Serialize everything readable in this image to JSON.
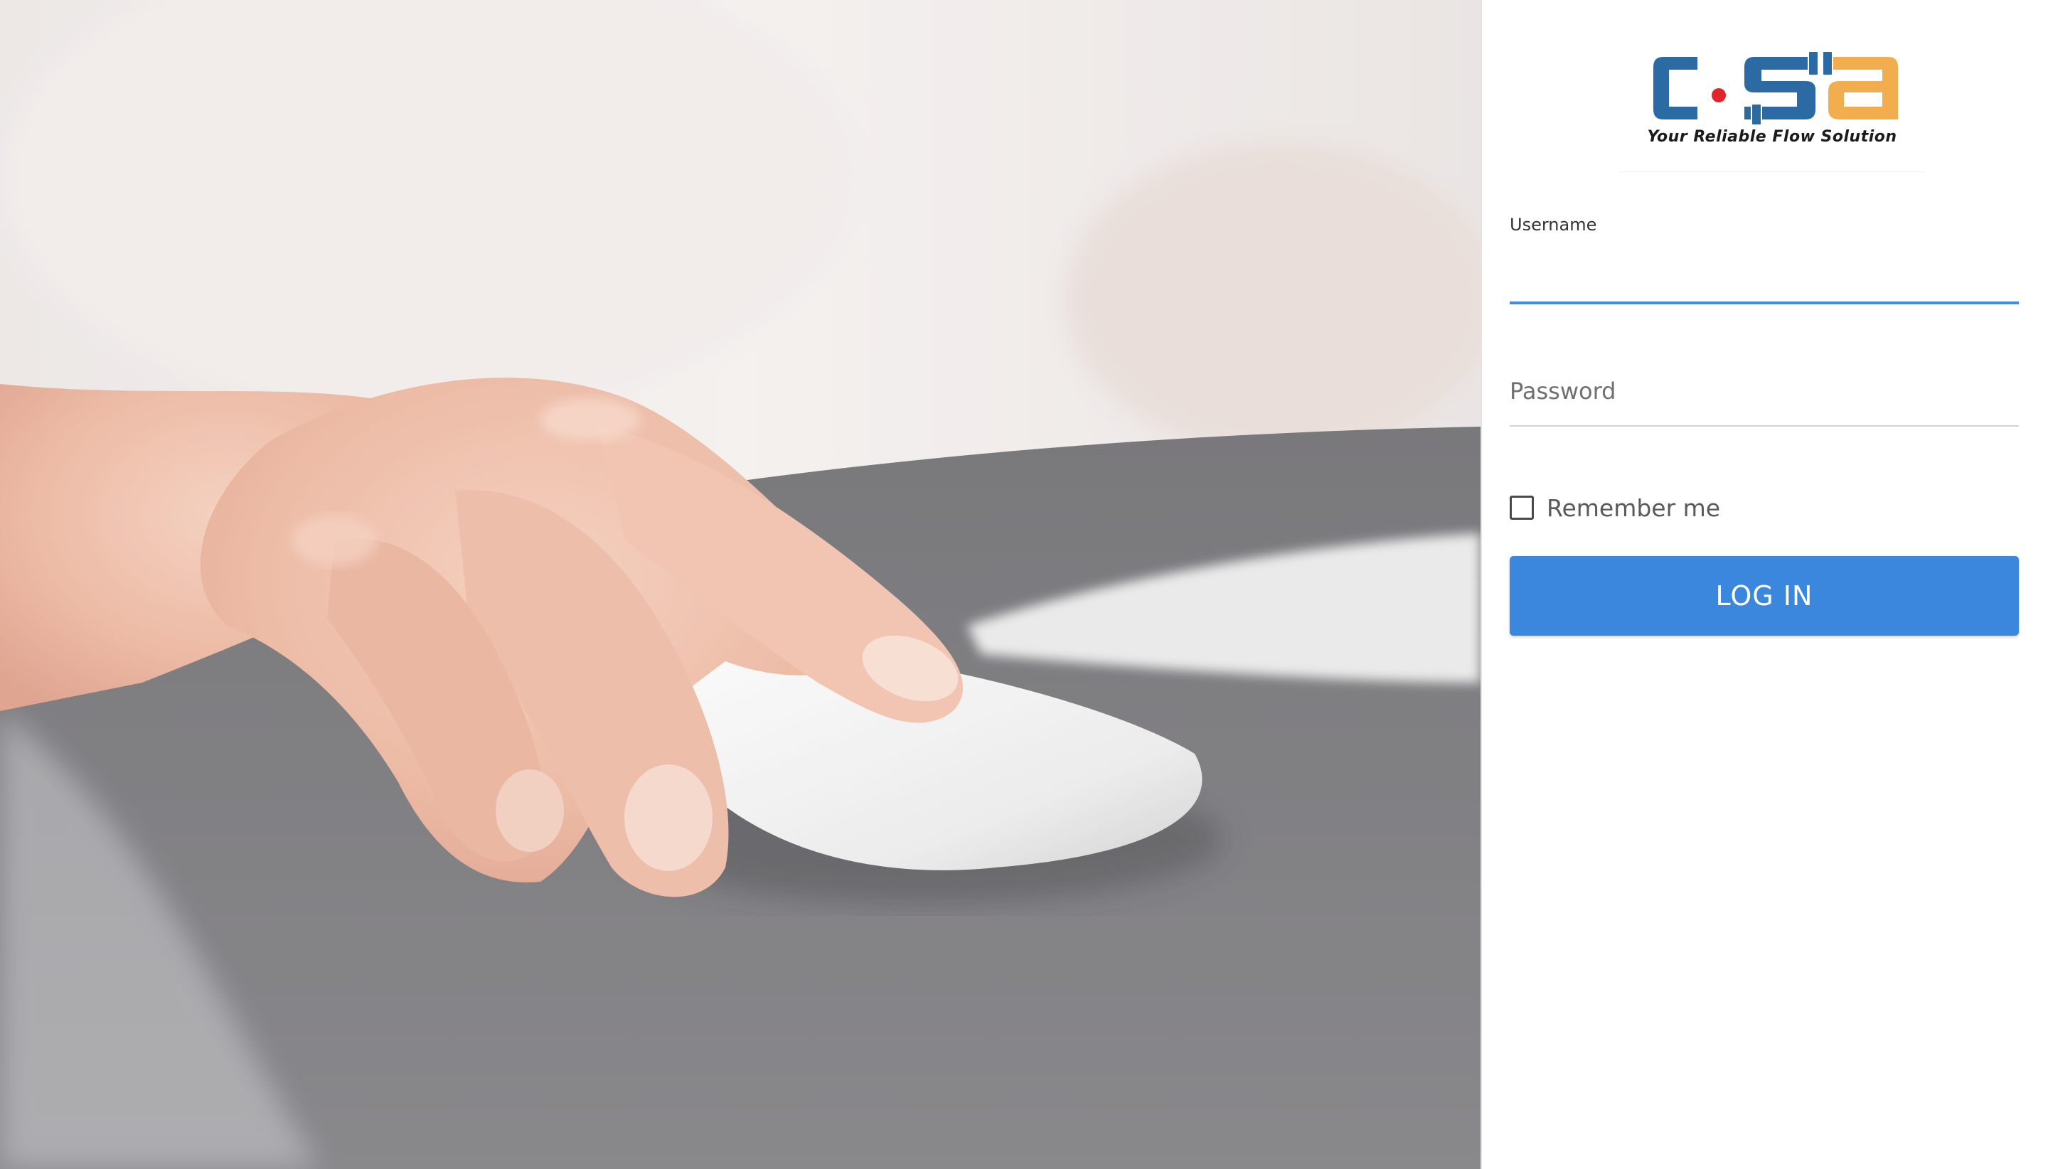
{
  "logo": {
    "tagline": "Your Reliable Flow Solution",
    "brand_colors": {
      "blue": "#2c6aa3",
      "orange": "#f2ad4e",
      "red_dot": "#e0262a"
    }
  },
  "form": {
    "username_label": "Username",
    "username_value": "",
    "password_placeholder": "Password",
    "password_value": "",
    "remember_label": "Remember me",
    "remember_checked": false,
    "login_label": "LOG IN"
  },
  "colors": {
    "accent": "#3b87dd",
    "input_focus_underline": "#3b8ee0"
  },
  "background": {
    "image_subject": "hand-on-mouse-photo"
  }
}
